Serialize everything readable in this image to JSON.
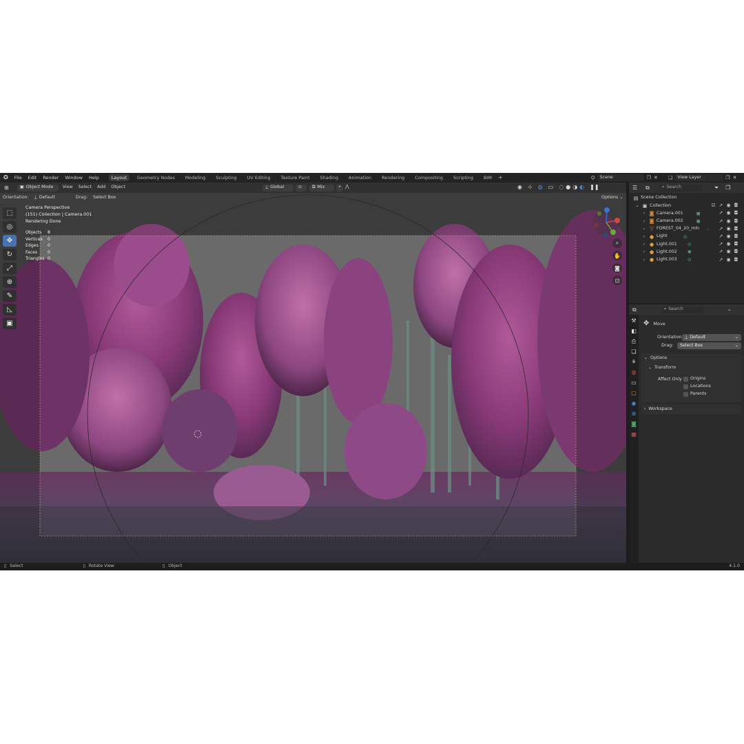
{
  "menu": {
    "items": [
      "File",
      "Edit",
      "Render",
      "Window",
      "Help"
    ]
  },
  "workspaces": [
    {
      "label": "Layout",
      "active": true
    },
    {
      "label": "Geometry Nodes",
      "active": false
    },
    {
      "label": "Modeling",
      "active": false
    },
    {
      "label": "Sculpting",
      "active": false
    },
    {
      "label": "UV Editing",
      "active": false
    },
    {
      "label": "Texture Paint",
      "active": false
    },
    {
      "label": "Shading",
      "active": false
    },
    {
      "label": "Animation",
      "active": false
    },
    {
      "label": "Rendering",
      "active": false
    },
    {
      "label": "Compositing",
      "active": false
    },
    {
      "label": "Scripting",
      "active": false
    },
    {
      "label": "BIM",
      "active": false
    }
  ],
  "add_tab": "+",
  "scene": {
    "name": "Scene",
    "view_layer": "View Layer"
  },
  "viewport_header": {
    "mode": "Object Mode",
    "menus": [
      "View",
      "Select",
      "Add",
      "Object"
    ],
    "transform_orientation": "Global",
    "pivot": "Mix"
  },
  "tool_header": {
    "orientation_label": "Orientation:",
    "orientation_value": "Default",
    "drag_label": "Drag:",
    "drag_value": "Select Box",
    "options": "Options"
  },
  "overlay": {
    "view_name": "Camera Perspective",
    "collection_line": "(151) Collection | Camera.001",
    "render_status": "Rendering Done"
  },
  "stats": [
    {
      "label": "Objects",
      "value": "8"
    },
    {
      "label": "Vertices",
      "value": "0"
    },
    {
      "label": "Edges",
      "value": "0"
    },
    {
      "label": "Faces",
      "value": "0"
    },
    {
      "label": "Triangles",
      "value": "0"
    }
  ],
  "outliner": {
    "search_placeholder": "Search",
    "scene_collection": "Scene Collection",
    "collection": "Collection",
    "items": [
      {
        "name": "Camera.001",
        "icon": "camera-icon"
      },
      {
        "name": "Camera.002",
        "icon": "camera-icon"
      },
      {
        "name": "FOREST_04_20_mln",
        "icon": "mesh-icon"
      },
      {
        "name": "Light",
        "icon": "light-icon"
      },
      {
        "name": "Light.001",
        "icon": "light-icon"
      },
      {
        "name": "Light.002",
        "icon": "light-icon"
      },
      {
        "name": "Light.003",
        "icon": "light-icon"
      }
    ]
  },
  "properties": {
    "search_placeholder": "Search",
    "tool_name": "Move",
    "orientation_label": "Orientation",
    "orientation_value": "Default",
    "drag_label": "Drag:",
    "drag_value": "Select Box",
    "options_label": "Options",
    "transform_label": "Transform",
    "affect_only_label": "Affect Only",
    "affect_options": [
      "Origins",
      "Locations",
      "Parents"
    ],
    "workspace_label": "Workspace"
  },
  "statusbar": {
    "items": [
      "Select",
      "Rotate View",
      "Object"
    ],
    "version": "4.1.0"
  },
  "colors": {
    "accent": "#4772b3",
    "camera_icon": "#5e8a8a",
    "light_icon": "#e0a040",
    "mesh_icon": "#e08a3a"
  }
}
